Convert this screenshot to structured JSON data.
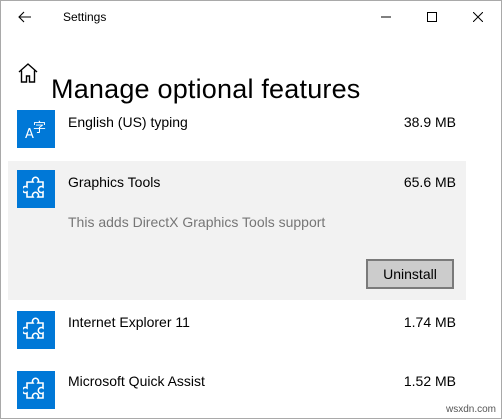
{
  "window": {
    "title": "Settings",
    "back_icon": "back-arrow-icon",
    "controls": {
      "minimize_icon": "minimize-icon",
      "maximize_icon": "maximize-icon",
      "close_icon": "close-icon"
    }
  },
  "header": {
    "home_icon": "home-icon",
    "title": "Manage optional features"
  },
  "features": [
    {
      "name": "English (US) typing",
      "size": "38.9 MB",
      "icon": "language-icon",
      "icon_glyph": "A字"
    },
    {
      "name": "Graphics Tools",
      "size": "65.6 MB",
      "icon": "puzzle-piece-icon",
      "expanded": true,
      "description": "This adds DirectX Graphics Tools support",
      "uninstall_label": "Uninstall"
    },
    {
      "name": "Internet Explorer 11",
      "size": "1.74 MB",
      "icon": "puzzle-piece-icon"
    },
    {
      "name": "Microsoft Quick Assist",
      "size": "1.52 MB",
      "icon": "puzzle-piece-icon"
    }
  ],
  "watermark": "wsxdn.com",
  "colors": {
    "accent": "#0078d7",
    "expanded_bg": "#f2f2f2",
    "secondary_text": "#767676",
    "button_bg": "#cccccc"
  }
}
